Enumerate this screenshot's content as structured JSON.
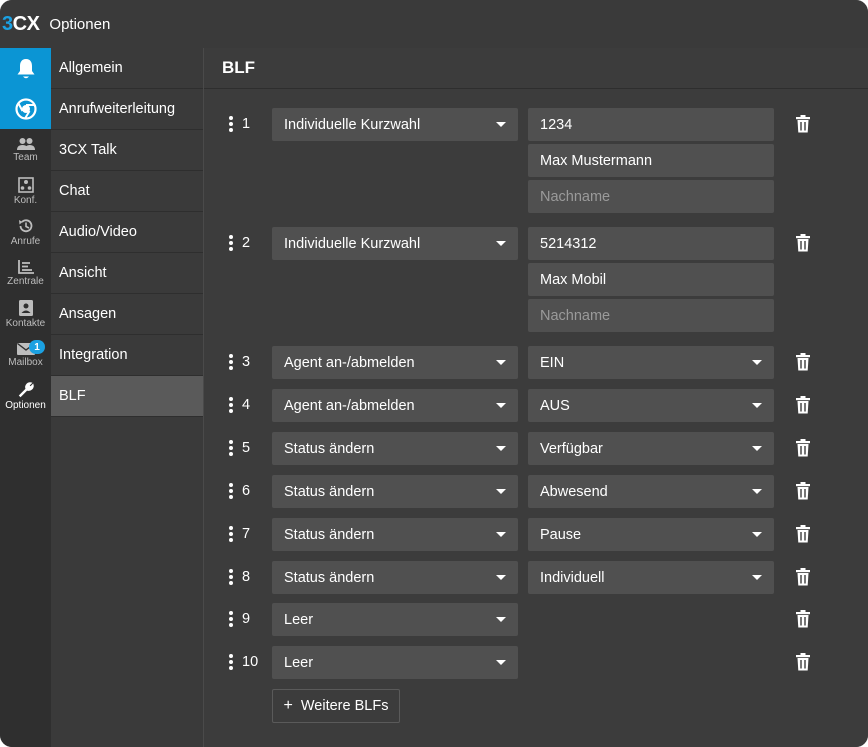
{
  "app": {
    "logo_3": "3",
    "logo_cx": "CX",
    "title": "Optionen"
  },
  "iconbar": {
    "items": [
      {
        "label": "Team",
        "icon": "team-icon"
      },
      {
        "label": "Konf.",
        "icon": "conference-icon"
      },
      {
        "label": "Anrufe",
        "icon": "history-icon"
      },
      {
        "label": "Zentrale",
        "icon": "switchboard-icon"
      },
      {
        "label": "Kontakte",
        "icon": "contacts-icon"
      },
      {
        "label": "Mailbox",
        "icon": "mail-icon",
        "badge": "1"
      },
      {
        "label": "Optionen",
        "icon": "wrench-icon"
      }
    ]
  },
  "menu": {
    "items": [
      "Allgemein",
      "Anrufweiterleitung",
      "3CX Talk",
      "Chat",
      "Audio/Video",
      "Ansicht",
      "Ansagen",
      "Integration",
      "BLF"
    ],
    "active": "BLF"
  },
  "content": {
    "title": "BLF",
    "rows": [
      {
        "num": "1",
        "type": "Individuelle Kurzwahl",
        "fields": [
          "1234",
          "Max Mustermann"
        ],
        "placeholder": "Nachname"
      },
      {
        "num": "2",
        "type": "Individuelle Kurzwahl",
        "fields": [
          "5214312",
          "Max Mobil"
        ],
        "placeholder": "Nachname"
      },
      {
        "num": "3",
        "type": "Agent an-/abmelden",
        "value": "EIN"
      },
      {
        "num": "4",
        "type": "Agent an-/abmelden",
        "value": "AUS"
      },
      {
        "num": "5",
        "type": "Status ändern",
        "value": "Verfügbar"
      },
      {
        "num": "6",
        "type": "Status ändern",
        "value": "Abwesend"
      },
      {
        "num": "7",
        "type": "Status ändern",
        "value": "Pause"
      },
      {
        "num": "8",
        "type": "Status ändern",
        "value": "Individuell"
      },
      {
        "num": "9",
        "type": "Leer"
      },
      {
        "num": "10",
        "type": "Leer"
      }
    ],
    "more_button": "Weitere BLFs",
    "more_plus": "+"
  },
  "colors": {
    "accent": "#0b95d4",
    "brand_blue": "#1ba1e2",
    "field_bg": "#505050",
    "bg": "#3c3c3c"
  }
}
